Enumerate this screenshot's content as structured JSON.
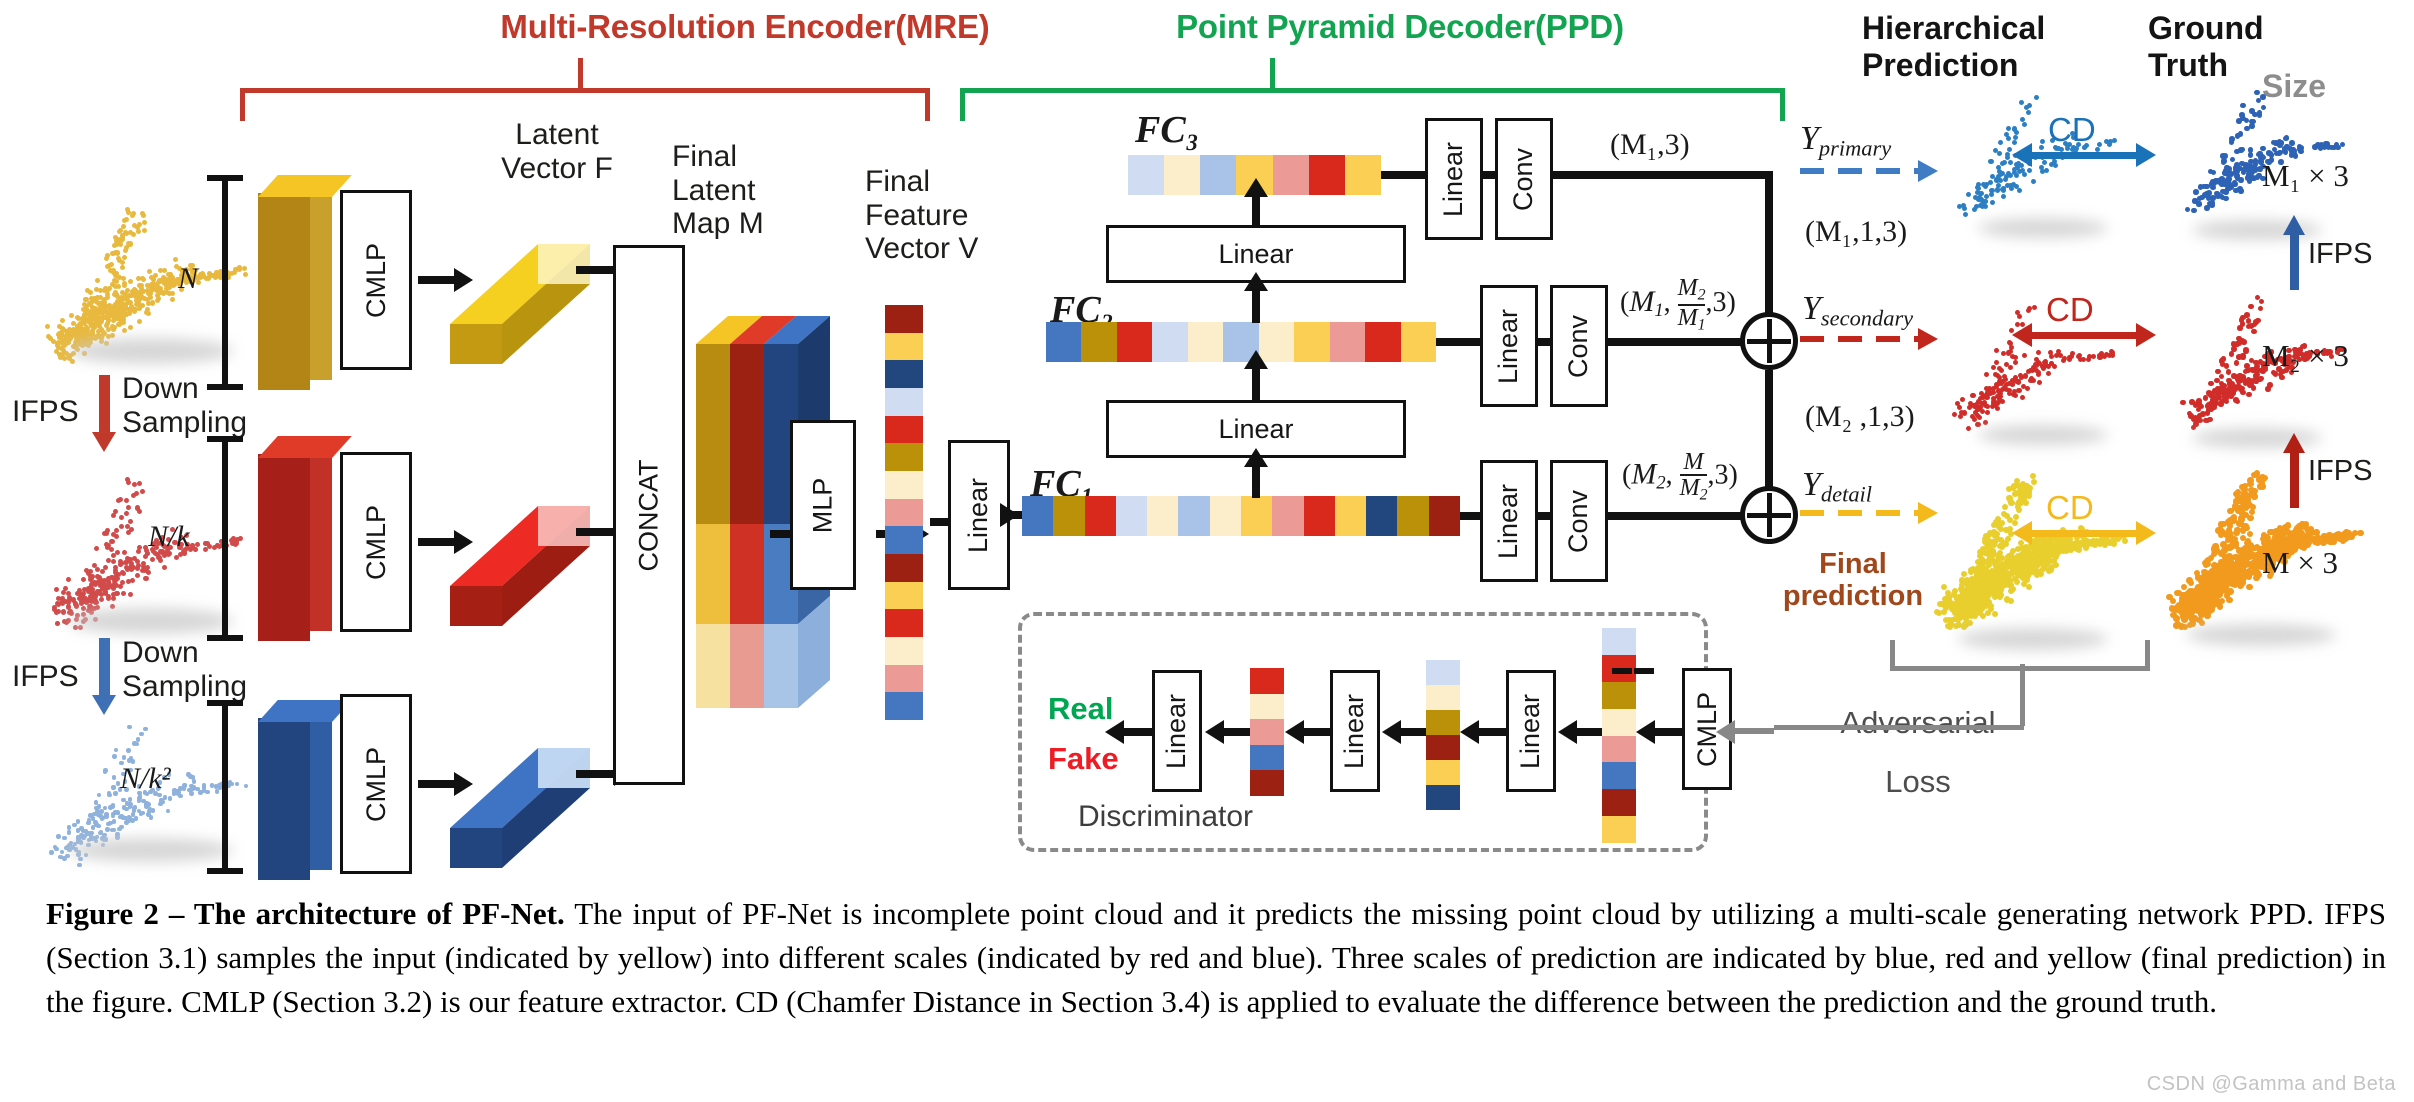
{
  "figure": {
    "sections": {
      "mre_label": "Multi-Resolution Encoder(MRE)",
      "ppd_label": "Point Pyramid Decoder(PPD)",
      "mre_color": "#c0392b",
      "ppd_color": "#13a452"
    },
    "encoder": {
      "latent_vector_label": [
        "Latent",
        "Vector F"
      ],
      "final_latent_map_label": [
        "Final",
        "Latent",
        "Map M"
      ],
      "final_feature_vector_label": [
        "Final",
        "Feature",
        "Vector V"
      ],
      "ifps_label": "IFPS",
      "downsampling_label": [
        "Down",
        "Sampling"
      ],
      "cmlp_label": "CMLP",
      "concat_label": "CONCAT",
      "mlp_label": "MLP",
      "linear_label": "Linear",
      "scale_labels": [
        "N",
        "N/k",
        "N/k²"
      ]
    },
    "decoder": {
      "fc3_label": "FC₃",
      "fc2_label": "FC₂",
      "fc1_label": "FC₁",
      "linear_label": "Linear",
      "conv_label": "Conv",
      "shapes": {
        "primary": "(M₁,3)",
        "primary_down": "(M₁,1,3)",
        "secondary": "(M₁, M₂/M₁ ,3)",
        "secondary_down": "(M₂ ,1,3)",
        "detail": "(M₂, M/M₂ ,3)"
      },
      "outputs": {
        "primary": "Y_primary",
        "secondary": "Y_secondary",
        "detail": "Y_detail"
      },
      "final_prediction_label": [
        "Final",
        "prediction"
      ],
      "final_prediction_color": "#a0471c"
    },
    "discriminator": {
      "title": "Discriminator",
      "cmlp_label": "CMLP",
      "linear_label": "Linear",
      "real_label": "Real",
      "fake_label": "Fake",
      "real_color": "#00a651",
      "fake_color": "#ee1c25",
      "adversarial_loss_label": [
        "Adversarial",
        "Loss"
      ]
    },
    "right_panel": {
      "hierarchical_prediction": [
        "Hierarchical",
        "Prediction"
      ],
      "ground_truth": [
        "Ground",
        "Truth"
      ],
      "size_label": "Size",
      "cd_label": "CD",
      "ifps_label": "IFPS",
      "sizes": [
        "M₁ × 3",
        "M₂ × 3",
        "M × 3"
      ],
      "cd_colors": [
        "#1a72b8",
        "#c0261c",
        "#f4b91a"
      ]
    },
    "palette": {
      "blue": "#4477c0",
      "dark_blue": "#22477e",
      "light_blue": "#cfdcf2",
      "light_blue2": "#a9c2e8",
      "red": "#d8291c",
      "dark_red": "#9c2113",
      "pink": "#eb9a96",
      "gold": "#fbcf53",
      "dark_gold": "#bb9109",
      "cream": "#fdeecb",
      "yellow": "#f8d231",
      "orange": "#f0a22c"
    }
  },
  "caption": {
    "prefix": "Figure 2 – The architecture of PF-Net.",
    "body": " The input of PF-Net is incomplete point cloud and it predicts the missing point cloud by utilizing a multi-scale generating network PPD. IFPS (Section 3.1) samples the input (indicated by yellow) into different scales (indicated by red and blue).  Three scales of prediction are indicated by blue, red and yellow (final prediction) in the figure.  CMLP (Section 3.2) is our feature extractor.  CD (Chamfer Distance in Section 3.4) is applied to evaluate the difference between the prediction and the ground truth.",
    "watermark": "CSDN @Gamma  and Beta"
  }
}
